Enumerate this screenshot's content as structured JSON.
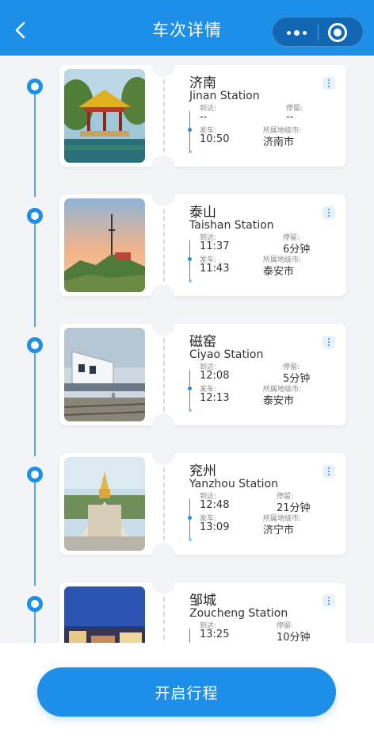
{
  "header": {
    "title": "车次详情",
    "back_icon": "chevron-left-icon",
    "more_icon": "more-dots-icon",
    "close_icon": "target-close-icon"
  },
  "labels": {
    "arrive": "到达:",
    "stay": "停留:",
    "depart": "发车:",
    "city": "所属地级市:"
  },
  "stations": [
    {
      "name": "济南",
      "en": "Jinan Station",
      "arrive": "--",
      "stay": "--",
      "depart": "10:50",
      "city": "济南市"
    },
    {
      "name": "泰山",
      "en": "Taishan Station",
      "arrive": "11:37",
      "stay": "6分钟",
      "depart": "11:43",
      "city": "泰安市"
    },
    {
      "name": "磁窑",
      "en": "Ciyao Station",
      "arrive": "12:08",
      "stay": "5分钟",
      "depart": "12:13",
      "city": "泰安市"
    },
    {
      "name": "兖州",
      "en": "Yanzhou Station",
      "arrive": "12:48",
      "stay": "21分钟",
      "depart": "13:09",
      "city": "济宁市"
    },
    {
      "name": "邹城",
      "en": "Zoucheng Station",
      "arrive": "13:25",
      "stay": "10分钟",
      "depart": "",
      "city": ""
    }
  ],
  "footer": {
    "start_label": "开启行程"
  },
  "colors": {
    "accent": "#1e8fe8",
    "background": "#f2f4f7"
  }
}
